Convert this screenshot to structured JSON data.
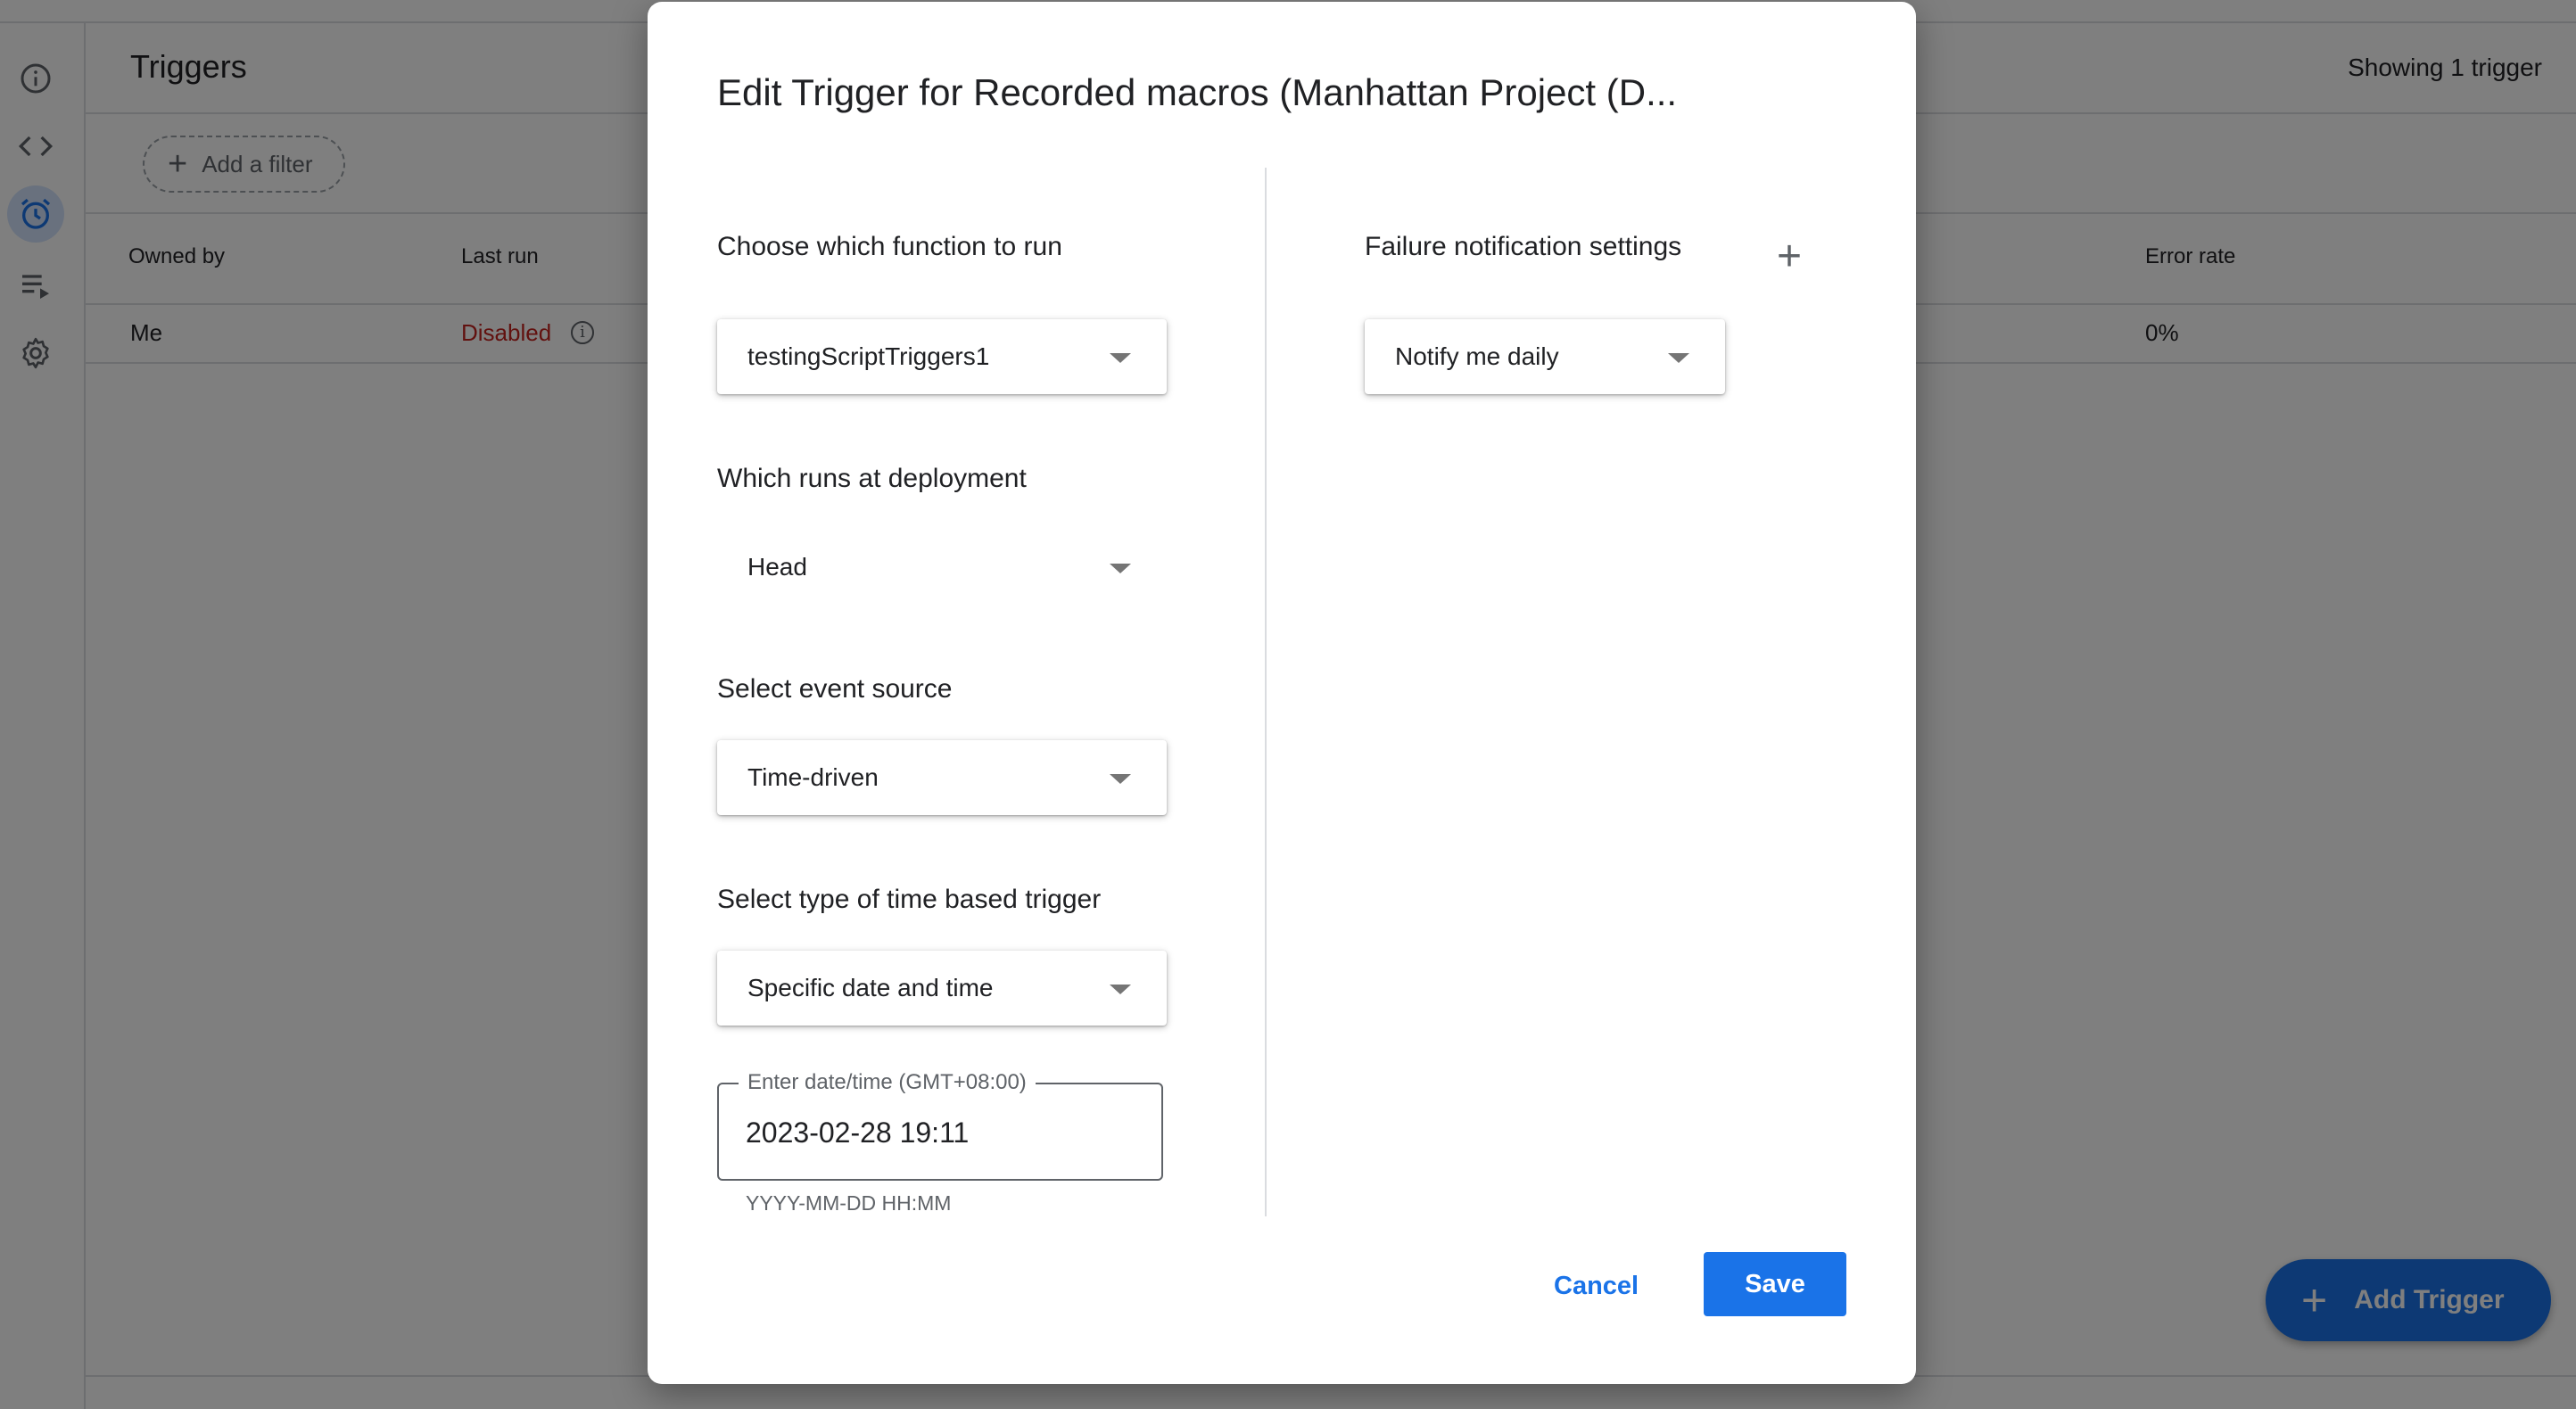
{
  "rail": {
    "items": [
      {
        "icon": "info-icon"
      },
      {
        "icon": "code-icon"
      },
      {
        "icon": "alarm-clock-icon",
        "active": true
      },
      {
        "icon": "executions-icon"
      },
      {
        "icon": "gear-icon"
      }
    ]
  },
  "background": {
    "title": "Triggers",
    "count": "Showing 1 trigger",
    "filter_label": "Add a filter",
    "columns": {
      "owned_by": "Owned by",
      "last_run": "Last run",
      "error_rate": "Error rate"
    },
    "row": {
      "owned_by": "Me",
      "last_run": "Disabled",
      "error_rate": "0%"
    },
    "fab_label": "Add Trigger"
  },
  "dialog": {
    "title": "Edit Trigger for Recorded macros (Manhattan Project (D...",
    "function_label": "Choose which function to run",
    "function_value": "testingScriptTriggers1",
    "deployment_label": "Which runs at deployment",
    "deployment_value": "Head",
    "event_source_label": "Select event source",
    "event_source_value": "Time-driven",
    "time_trigger_label": "Select type of time based trigger",
    "time_trigger_value": "Specific date and time",
    "date_field_label": "Enter date/time (GMT+08:00)",
    "date_field_value": "2023-02-28 19:11",
    "date_field_helper": "YYYY-MM-DD HH:MM",
    "failure_label": "Failure notification settings",
    "failure_value": "Notify me daily",
    "cancel_label": "Cancel",
    "save_label": "Save"
  },
  "colors": {
    "accent": "#1a73e8",
    "error": "#c5221f",
    "scrim": "rgba(0,0,0,0.5)"
  }
}
